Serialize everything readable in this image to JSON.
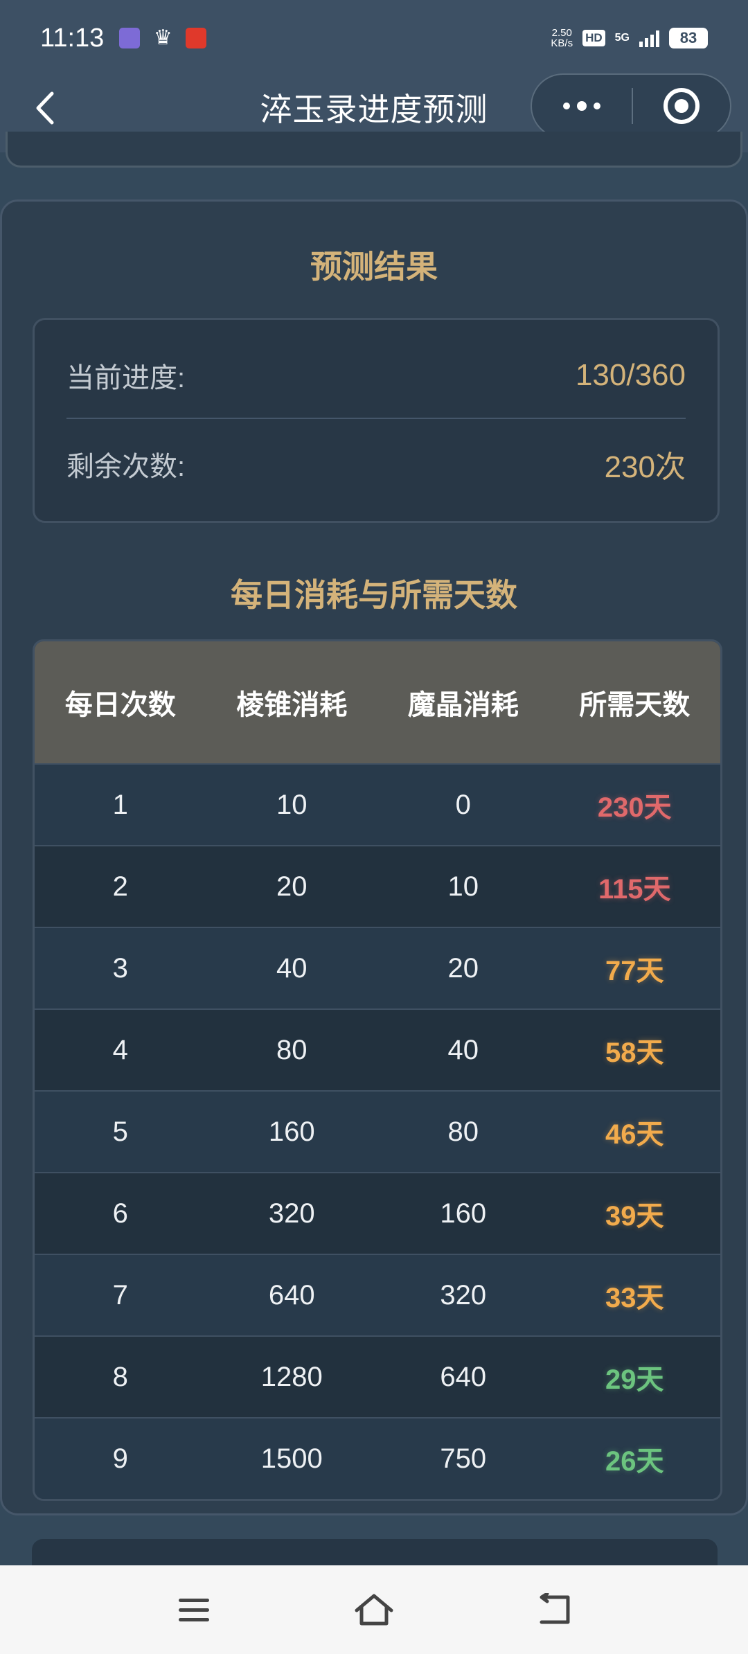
{
  "status_bar": {
    "time": "11:13",
    "net_speed_value": "2.50",
    "net_speed_unit": "KB/s",
    "hd_label": "HD",
    "network_type": "5G",
    "battery": "83"
  },
  "nav": {
    "title": "淬玉录进度预测"
  },
  "result": {
    "title": "预测结果",
    "current_progress_label": "当前进度:",
    "current_progress_value": "130/360",
    "remaining_label": "剩余次数:",
    "remaining_value": "230次"
  },
  "table": {
    "title": "每日消耗与所需天数",
    "headers": [
      "每日次数",
      "棱锥消耗",
      "魔晶消耗",
      "所需天数"
    ],
    "rows": [
      {
        "daily": "1",
        "pyramid": "10",
        "crystal": "0",
        "days": "230天",
        "color": "#e0696b"
      },
      {
        "daily": "2",
        "pyramid": "20",
        "crystal": "10",
        "days": "115天",
        "color": "#e0696b"
      },
      {
        "daily": "3",
        "pyramid": "40",
        "crystal": "20",
        "days": "77天",
        "color": "#f2ab4c"
      },
      {
        "daily": "4",
        "pyramid": "80",
        "crystal": "40",
        "days": "58天",
        "color": "#f2ab4c"
      },
      {
        "daily": "5",
        "pyramid": "160",
        "crystal": "80",
        "days": "46天",
        "color": "#f2ab4c"
      },
      {
        "daily": "6",
        "pyramid": "320",
        "crystal": "160",
        "days": "39天",
        "color": "#f2ab4c"
      },
      {
        "daily": "7",
        "pyramid": "640",
        "crystal": "320",
        "days": "33天",
        "color": "#f2ab4c"
      },
      {
        "daily": "8",
        "pyramid": "1280",
        "crystal": "640",
        "days": "29天",
        "color": "#6cc47f"
      },
      {
        "daily": "9",
        "pyramid": "1500",
        "crystal": "750",
        "days": "26天",
        "color": "#6cc47f"
      }
    ]
  },
  "colors": {
    "accent_gold": "#d4b37a",
    "danger_red": "#e0696b",
    "warn_orange": "#f2ab4c",
    "ok_green": "#6cc47f"
  },
  "icons": {
    "back": "chevron-left-icon",
    "more": "more-dots-icon",
    "close": "target-circle-icon",
    "sys_menu": "menu-icon",
    "sys_home": "home-icon",
    "sys_back": "return-icon"
  }
}
